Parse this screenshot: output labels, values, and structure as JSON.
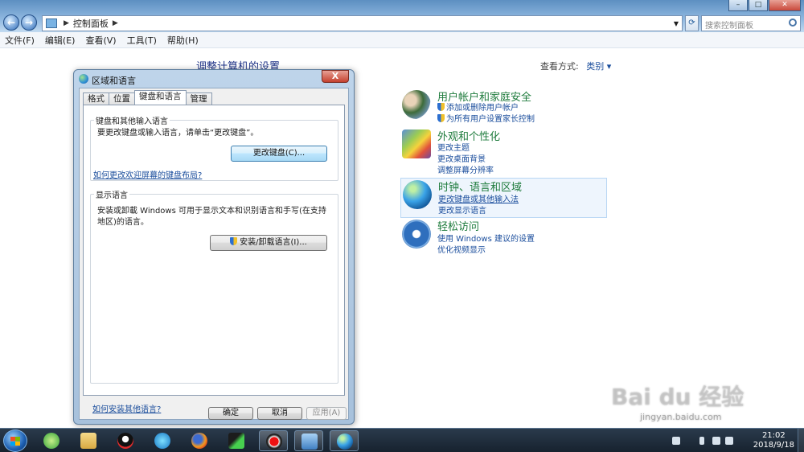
{
  "window": {
    "breadcrumb": "控制面板",
    "search_placeholder": "搜索控制面板",
    "controls": {
      "minimize": "–",
      "maximize": "□",
      "close": "✕"
    }
  },
  "menu": [
    "文件(F)",
    "编辑(E)",
    "查看(V)",
    "工具(T)",
    "帮助(H)"
  ],
  "control_panel": {
    "title": "调整计算机的设置",
    "view_by_label": "查看方式:",
    "view_by_value": "类别",
    "categories": [
      {
        "title": "用户帐户和家庭安全",
        "links": [
          "添加或删除用户帐户",
          "为所有用户设置家长控制"
        ]
      },
      {
        "title": "外观和个性化",
        "links": [
          "更改主题",
          "更改桌面背景",
          "调整屏幕分辨率"
        ]
      },
      {
        "title": "时钟、语言和区域",
        "links": [
          "更改键盘或其他输入法",
          "更改显示语言"
        ]
      },
      {
        "title": "轻松访问",
        "links": [
          "使用 Windows 建议的设置",
          "优化视频显示"
        ]
      }
    ]
  },
  "dialog": {
    "title": "区域和语言",
    "close": "X",
    "tabs": [
      "格式",
      "位置",
      "键盘和语言",
      "管理"
    ],
    "active_tab": "键盘和语言",
    "keyboard_group": {
      "label": "键盘和其他输入语言",
      "description": "要更改键盘或输入语言，请单击“更改键盘”。",
      "button": "更改键盘(C)...",
      "link": "如何更改欢迎屏幕的键盘布局?"
    },
    "display_group": {
      "label": "显示语言",
      "description": "安装或卸載 Windows 可用于显示文本和识别语言和手写(在支持地区)的语言。",
      "button": "安装/卸载语言(I)..."
    },
    "install_link": "如何安装其他语言?",
    "buttons": {
      "ok": "确定",
      "cancel": "取消",
      "apply": "应用(A)"
    }
  },
  "taskbar": {
    "clock_time": "21:02",
    "clock_date": "2018/9/18"
  },
  "watermark": {
    "logo": "Bai du 经验",
    "url": "jingyan.baidu.com"
  },
  "colors": {
    "category_title": "#1e7b3c",
    "link": "#1a4d9c",
    "heading": "#1e3287"
  }
}
